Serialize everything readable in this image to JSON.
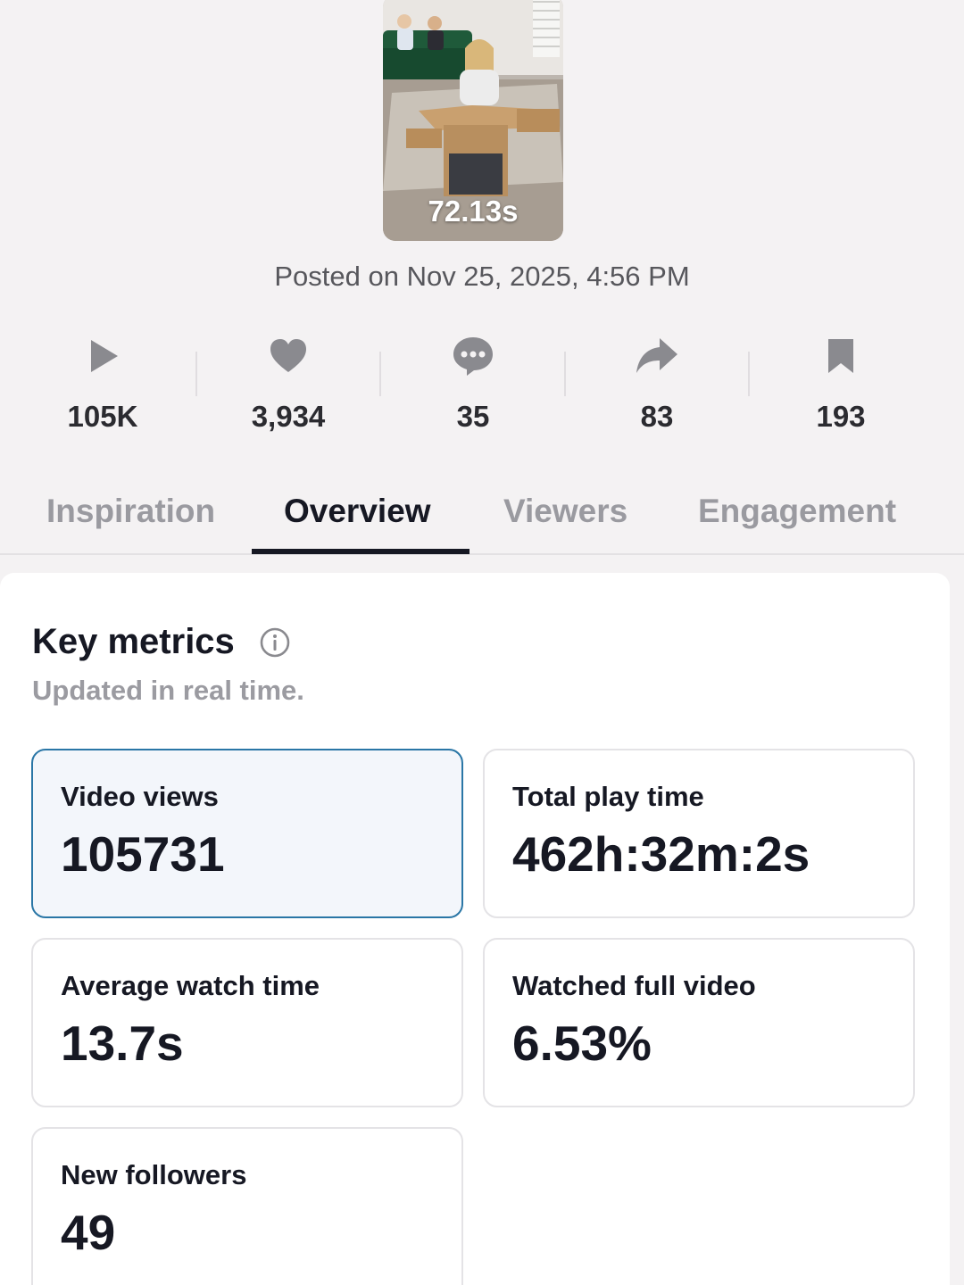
{
  "video": {
    "duration": "72.13s",
    "posted": "Posted on Nov 25, 2025, 4:56 PM"
  },
  "stats": [
    {
      "icon": "play-icon",
      "value": "105K"
    },
    {
      "icon": "heart-icon",
      "value": "3,934"
    },
    {
      "icon": "comment-icon",
      "value": "35"
    },
    {
      "icon": "share-icon",
      "value": "83"
    },
    {
      "icon": "bookmark-icon",
      "value": "193"
    }
  ],
  "tabs": [
    {
      "label": "Inspiration",
      "active": false
    },
    {
      "label": "Overview",
      "active": true
    },
    {
      "label": "Viewers",
      "active": false
    },
    {
      "label": "Engagement",
      "active": false
    }
  ],
  "key_metrics": {
    "title": "Key metrics",
    "subtitle": "Updated in real time.",
    "items": [
      {
        "label": "Video views",
        "value": "105731",
        "selected": true
      },
      {
        "label": "Total play time",
        "value": "462h:32m:2s",
        "selected": false
      },
      {
        "label": "Average watch time",
        "value": "13.7s",
        "selected": false
      },
      {
        "label": "Watched full video",
        "value": "6.53%",
        "selected": false
      },
      {
        "label": "New followers",
        "value": "49",
        "selected": false
      }
    ]
  },
  "colors": {
    "background": "#f4f2f3",
    "text_primary": "#161823",
    "text_muted": "#9b9ba1",
    "selected_border": "#2a76a6",
    "selected_fill": "#f3f6fb",
    "icon_gray": "#8a8a8f"
  }
}
